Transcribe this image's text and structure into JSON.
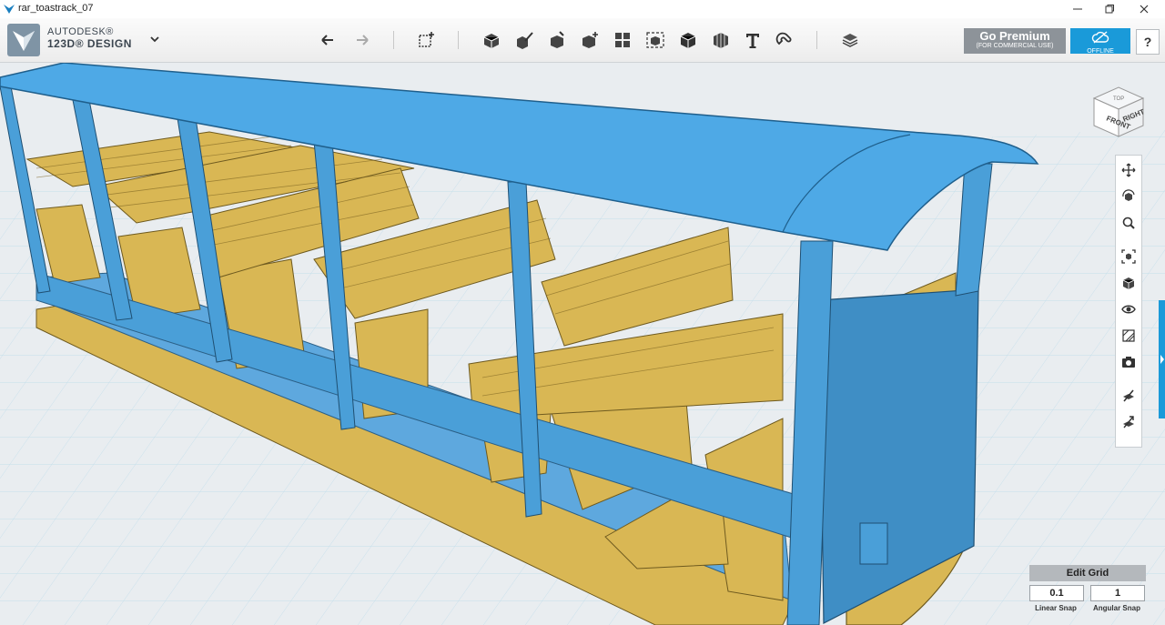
{
  "window": {
    "title": "rar_toastrack_07",
    "controls": [
      "minimize-icon",
      "restore-icon",
      "close-icon"
    ]
  },
  "brand": {
    "line1": "AUTODESK®",
    "line2": "123D® DESIGN"
  },
  "toolbar": {
    "tools": [
      "undo-icon",
      "redo-icon",
      "primitives-icon",
      "sketch-icon",
      "construct-icon",
      "modify-icon",
      "pattern-icon",
      "grouping-icon",
      "combine-icon",
      "measure-icon",
      "text-icon",
      "snap-icon",
      "material-icon"
    ]
  },
  "premium": {
    "label": "Go Premium",
    "sublabel": "(FOR COMMERCIAL USE)"
  },
  "offline": {
    "label": "OFFLINE"
  },
  "help": {
    "label": "?"
  },
  "viewcube": {
    "front": "FRONT",
    "right": "RIGHT",
    "top": "TOP"
  },
  "navbar": {
    "tools": [
      "pan-icon",
      "orbit-icon",
      "zoom-icon",
      "fit-icon",
      "views-icon",
      "visibility-icon",
      "materials-icon",
      "camera-icon",
      "snap-tool-icon",
      "settings-icon"
    ]
  },
  "grid": {
    "edit_label": "Edit Grid",
    "linear_snap_value": "0.1",
    "linear_snap_label": "Linear Snap",
    "angular_snap_value": "1",
    "angular_snap_label": "Angular Snap"
  },
  "colors": {
    "accent": "#1a9ad9",
    "model_blue": "#4a9fd8",
    "model_gold": "#d9b754",
    "grid_line": "#c6dfeb"
  }
}
